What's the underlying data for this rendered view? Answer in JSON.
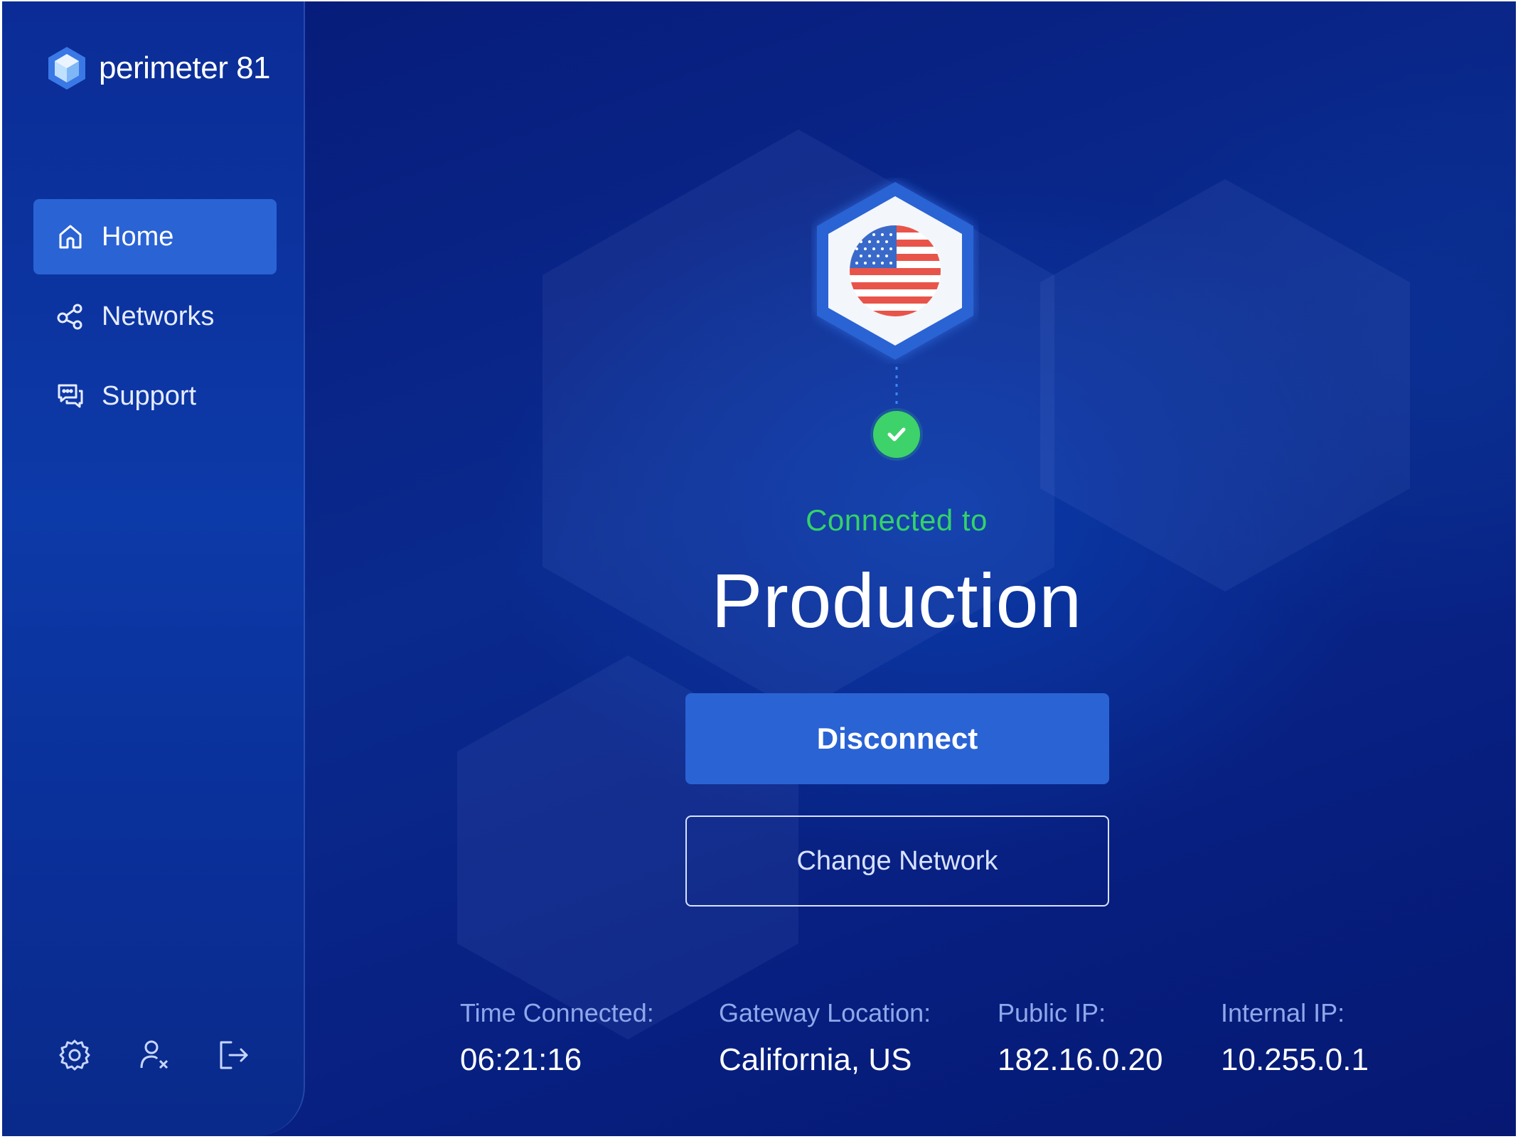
{
  "app": {
    "brand_name": "perimeter 81"
  },
  "sidebar": {
    "items": [
      {
        "label": "Home",
        "icon": "home-icon",
        "active": true
      },
      {
        "label": "Networks",
        "icon": "share-nodes-icon",
        "active": false
      },
      {
        "label": "Support",
        "icon": "chat-bubbles-icon",
        "active": false
      }
    ],
    "footer_icons": [
      "gear-icon",
      "user-remove-icon",
      "logout-icon"
    ]
  },
  "connection": {
    "flag_icon": "us-flag-icon",
    "status_icon": "check-icon",
    "status_label": "Connected to",
    "network_name": "Production"
  },
  "actions": {
    "disconnect_label": "Disconnect",
    "change_network_label": "Change Network"
  },
  "stats": [
    {
      "label": "Time Connected:",
      "value": "06:21:16"
    },
    {
      "label": "Gateway Location:",
      "value": "California, US"
    },
    {
      "label": "Public IP:",
      "value": "182.16.0.20"
    },
    {
      "label": "Internal IP:",
      "value": "10.255.0.1"
    }
  ],
  "colors": {
    "background": "#0a2a8e",
    "sidebar": "#0c3aa8",
    "accent": "#2a63d4",
    "success": "#3ed26a",
    "muted_label": "#8fa8ea"
  }
}
